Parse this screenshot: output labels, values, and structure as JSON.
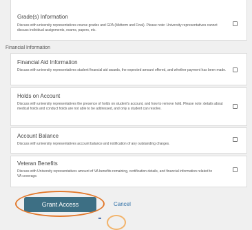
{
  "permissions_top": [
    {
      "title": "Grade(s) Information",
      "description": "Discuss with university representatives course grades and GPA (Midterm and Final). Please note: University representatives cannot discuss individual assignments, exams, papers, etc."
    }
  ],
  "section": {
    "label": "Financial Information"
  },
  "permissions_financial": [
    {
      "title": "Financial Aid Information",
      "description": "Discuss with university representatives student financial aid awards, the expected amount offered, and whether payment has been made."
    },
    {
      "title": "Holds on Account",
      "description": "Discuss with university representatives the presence of holds on student's account, and how to remove hold. Please note: details about medical holds and conduct holds are not able to be addressed, and only a student can resolve."
    },
    {
      "title": "Account Balance",
      "description": "Discuss with university representatives account balance and notification of any outstanding charges."
    },
    {
      "title": "Veteran Benefits",
      "description": "Discuss with University representatives amount of VA benefits remaining, certification details, and financial information related to VA coverage."
    }
  ],
  "actions": {
    "grant_label": "Grant Access",
    "cancel_label": "Cancel"
  },
  "colors": {
    "primary_button": "#3d6f84",
    "link": "#2c6ea6",
    "highlight_annotation": "#e27a2e"
  }
}
